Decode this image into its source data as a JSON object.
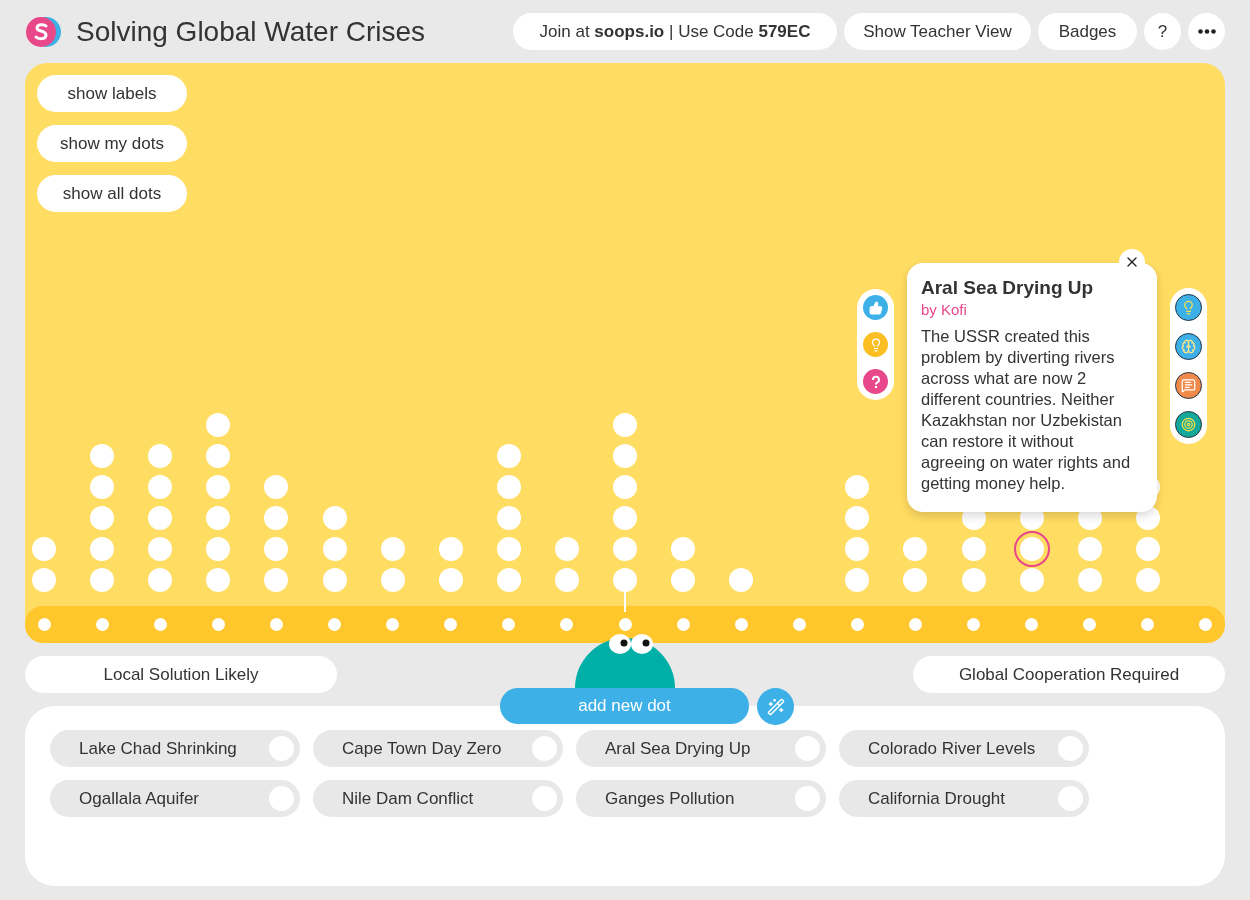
{
  "header": {
    "title": "Solving Global Water Crises",
    "join": "Join at **soops.io** | Use Code **579EC**",
    "buttons": [
      "Show Teacher View",
      "Badges",
      "?"
    ]
  },
  "view_buttons": [
    "show labels",
    "show my dots",
    "show all dots"
  ],
  "columns": [
    {
      "pointed": false,
      "dots": [
        {
          "selected": false
        },
        {
          "selected": false
        }
      ]
    },
    {
      "pointed": false,
      "dots": [
        {
          "selected": false
        },
        {
          "selected": false
        },
        {
          "selected": false
        },
        {
          "selected": false
        },
        {
          "selected": false
        }
      ]
    },
    {
      "pointed": false,
      "dots": [
        {
          "selected": false
        },
        {
          "selected": false
        },
        {
          "selected": false
        },
        {
          "selected": false
        },
        {
          "selected": false
        }
      ]
    },
    {
      "pointed": false,
      "dots": [
        {
          "selected": false
        },
        {
          "selected": false
        },
        {
          "selected": false
        },
        {
          "selected": false
        },
        {
          "selected": false
        },
        {
          "selected": false
        }
      ]
    },
    {
      "pointed": false,
      "dots": [
        {
          "selected": false
        },
        {
          "selected": false
        },
        {
          "selected": false
        },
        {
          "selected": false
        }
      ]
    },
    {
      "pointed": false,
      "dots": [
        {
          "selected": false
        },
        {
          "selected": false
        },
        {
          "selected": false
        }
      ]
    },
    {
      "pointed": false,
      "dots": [
        {
          "selected": false
        },
        {
          "selected": false
        }
      ]
    },
    {
      "pointed": false,
      "dots": [
        {
          "selected": false
        },
        {
          "selected": false
        }
      ]
    },
    {
      "pointed": false,
      "dots": [
        {
          "selected": false
        },
        {
          "selected": false
        },
        {
          "selected": false
        },
        {
          "selected": false
        },
        {
          "selected": false
        }
      ]
    },
    {
      "pointed": false,
      "dots": [
        {
          "selected": false
        },
        {
          "selected": false
        }
      ]
    },
    {
      "pointed": true,
      "dots": [
        {
          "selected": false
        },
        {
          "selected": false
        },
        {
          "selected": false
        },
        {
          "selected": false
        },
        {
          "selected": false
        },
        {
          "selected": false
        }
      ]
    },
    {
      "pointed": false,
      "dots": [
        {
          "selected": false
        },
        {
          "selected": false
        }
      ]
    },
    {
      "pointed": false,
      "dots": [
        {
          "selected": false
        }
      ]
    },
    {
      "pointed": false
    },
    {
      "pointed": false,
      "dots": [
        {
          "selected": false
        },
        {
          "selected": false
        },
        {
          "selected": false
        },
        {
          "selected": false
        }
      ]
    },
    {
      "pointed": false,
      "dots": [
        {
          "selected": false
        },
        {
          "selected": false
        }
      ]
    },
    {
      "pointed": false,
      "dots": [
        {
          "selected": false
        },
        {
          "selected": false
        },
        {
          "selected": false
        }
      ]
    },
    {
      "pointed": false,
      "dots": [
        {
          "selected": false
        },
        {
          "selected": true
        },
        {
          "selected": false
        }
      ]
    },
    {
      "pointed": false,
      "dots": [
        {
          "selected": false
        },
        {
          "selected": false
        },
        {
          "selected": false
        }
      ]
    },
    {
      "pointed": false,
      "dots": [
        {
          "selected": false
        },
        {
          "selected": false
        },
        {
          "selected": false
        },
        {
          "selected": false
        }
      ]
    },
    {
      "pointed": false
    }
  ],
  "popup": {
    "title": "Aral Sea Drying Up",
    "author": "by Kofi",
    "body": "The USSR created this problem by diverting rivers across what are now 2 different countries. Neither Kazakhstan nor Uzbekistan can restore it without agreeing on water rights and getting money help."
  },
  "axis_labels": [
    "Local Solution Likely",
    "Global Cooperation Required"
  ],
  "add_button": "add new dot",
  "topics": [
    {
      "label": "Lake Chad Shrinking",
      "selected": false
    },
    {
      "label": "Cape Town Day Zero",
      "selected": false
    },
    {
      "label": "Aral Sea Drying Up",
      "selected": false
    },
    {
      "label": "Colorado River Levels",
      "selected": false
    },
    {
      "label": "Ogallala Aquifer",
      "selected": false
    },
    {
      "label": "Nile Dam Conflict",
      "selected": false
    },
    {
      "label": "Ganges Pollution",
      "selected": false
    },
    {
      "label": "California Drought",
      "selected": false
    }
  ]
}
